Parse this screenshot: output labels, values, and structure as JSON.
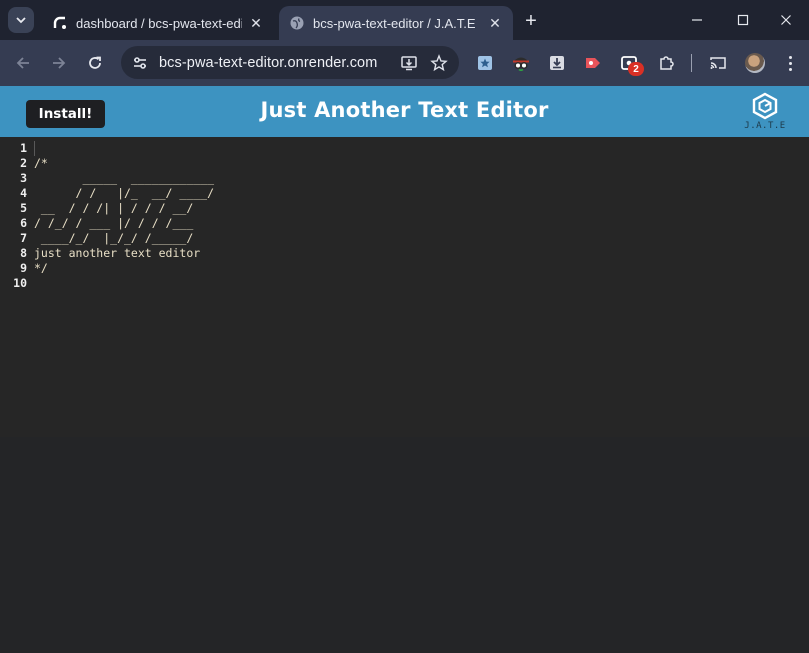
{
  "browser": {
    "tabs": [
      {
        "title": "dashboard / bcs-pwa-text-editor",
        "favicon": "render-logo-icon",
        "active": false
      },
      {
        "title": "bcs-pwa-text-editor / J.A.T.E",
        "favicon": "globe-icon",
        "active": true
      }
    ],
    "new_tab_label": "+",
    "url": "bcs-pwa-text-editor.onrender.com",
    "extension_badge": "2",
    "colors": {
      "tabstrip": "#1f2330",
      "toolbar": "#353c52",
      "omnibox": "#262b3a"
    }
  },
  "app": {
    "install_label": "Install!",
    "title": "Just Another Text Editor",
    "logo_caption": "J.A.T.E",
    "colors": {
      "header": "#3d93c1",
      "install_button": "#1e1f22"
    }
  },
  "editor": {
    "line_numbers": [
      "1",
      "2",
      "3",
      "4",
      "5",
      "6",
      "7",
      "8",
      "9",
      "10"
    ],
    "lines": [
      "",
      "/*",
      "       _____  ____________",
      "      / /   |/_  __/ ____/",
      " __  / / /| | / / / __/",
      "/ /_/ / ___ |/ / / /___",
      " ____/_/  |_/_/ /_____/",
      "just another text editor",
      "*/",
      ""
    ],
    "colors": {
      "background": "#262626",
      "text": "#e8dfc6",
      "gutter_text": "#f0f0f0"
    }
  }
}
